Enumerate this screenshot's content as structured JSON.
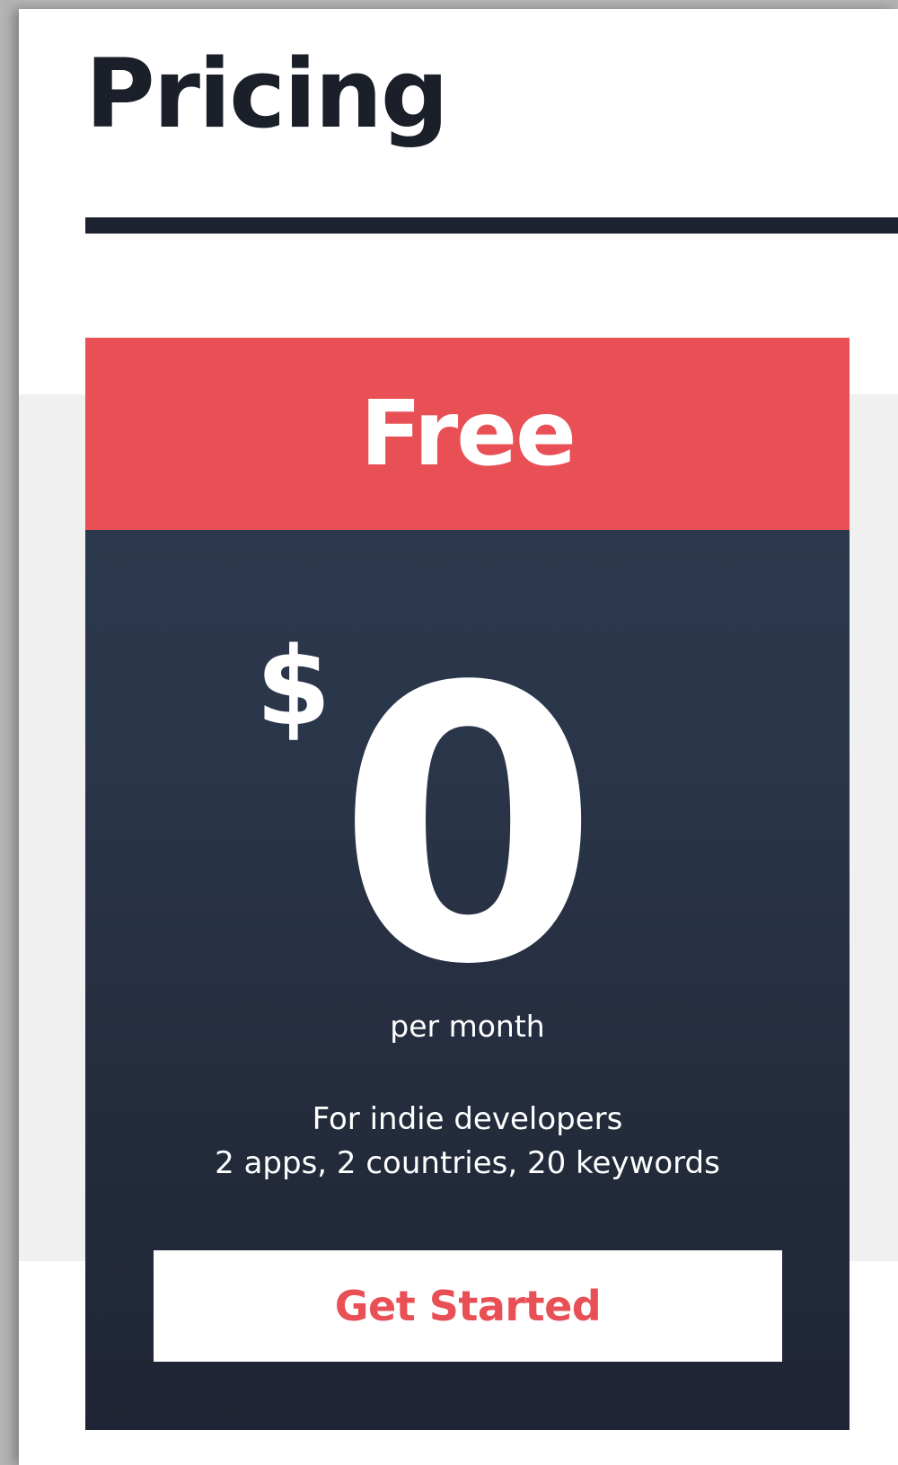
{
  "page": {
    "title": "Pricing"
  },
  "plan": {
    "name": "Free",
    "currency_symbol": "$",
    "price": "0",
    "period": "per month",
    "audience": "For indie developers",
    "limits": "2 apps, 2 countries, 20 keywords",
    "cta_label": "Get Started"
  },
  "colors": {
    "accent": "#e85056",
    "card_top": "#2d3a50",
    "card_bottom": "#1f2534",
    "heading_text": "#1b1f2a",
    "band_background": "#f0f0f0"
  }
}
